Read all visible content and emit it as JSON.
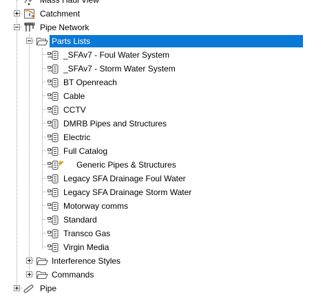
{
  "tree": {
    "nodes": {
      "mass_haul_view": {
        "label": "Mass Haul View",
        "icon": "mass-haul-icon"
      },
      "catchment": {
        "label": "Catchment",
        "icon": "catchment-icon"
      },
      "pipe_network": {
        "label": "Pipe Network",
        "icon": "pipe-network-icon"
      },
      "parts_lists": {
        "label": "Parts Lists",
        "icon": "folder-open-icon",
        "selected": true
      },
      "interference_styles": {
        "label": "Interference Styles",
        "icon": "folder-open-icon"
      },
      "commands": {
        "label": "Commands",
        "icon": "folder-open-icon"
      },
      "pipe": {
        "label": "Pipe",
        "icon": "pipe-icon"
      }
    },
    "parts_lists_items": [
      {
        "label": "_SFAv7 - Foul Water System"
      },
      {
        "label": "_SFAv7 - Storm Water System"
      },
      {
        "label": "BT Openreach"
      },
      {
        "label": "Cable"
      },
      {
        "label": "CCTV"
      },
      {
        "label": "DMRB Pipes and Structures"
      },
      {
        "label": "Electric"
      },
      {
        "label": "Full Catalog"
      },
      {
        "label": "Generic Pipes & Structures",
        "flag": "default-marker"
      },
      {
        "label": "Legacy SFA Drainage Foul Water"
      },
      {
        "label": "Legacy SFA Drainage Storm Water"
      },
      {
        "label": "Motorway comms"
      },
      {
        "label": "Standard"
      },
      {
        "label": "Transco Gas"
      },
      {
        "label": "Virgin Media"
      }
    ],
    "colors": {
      "selection": "#0a78d7",
      "selection_text": "#ffffff",
      "connector": "#a0a0a0",
      "flag": "#e0a000"
    }
  }
}
